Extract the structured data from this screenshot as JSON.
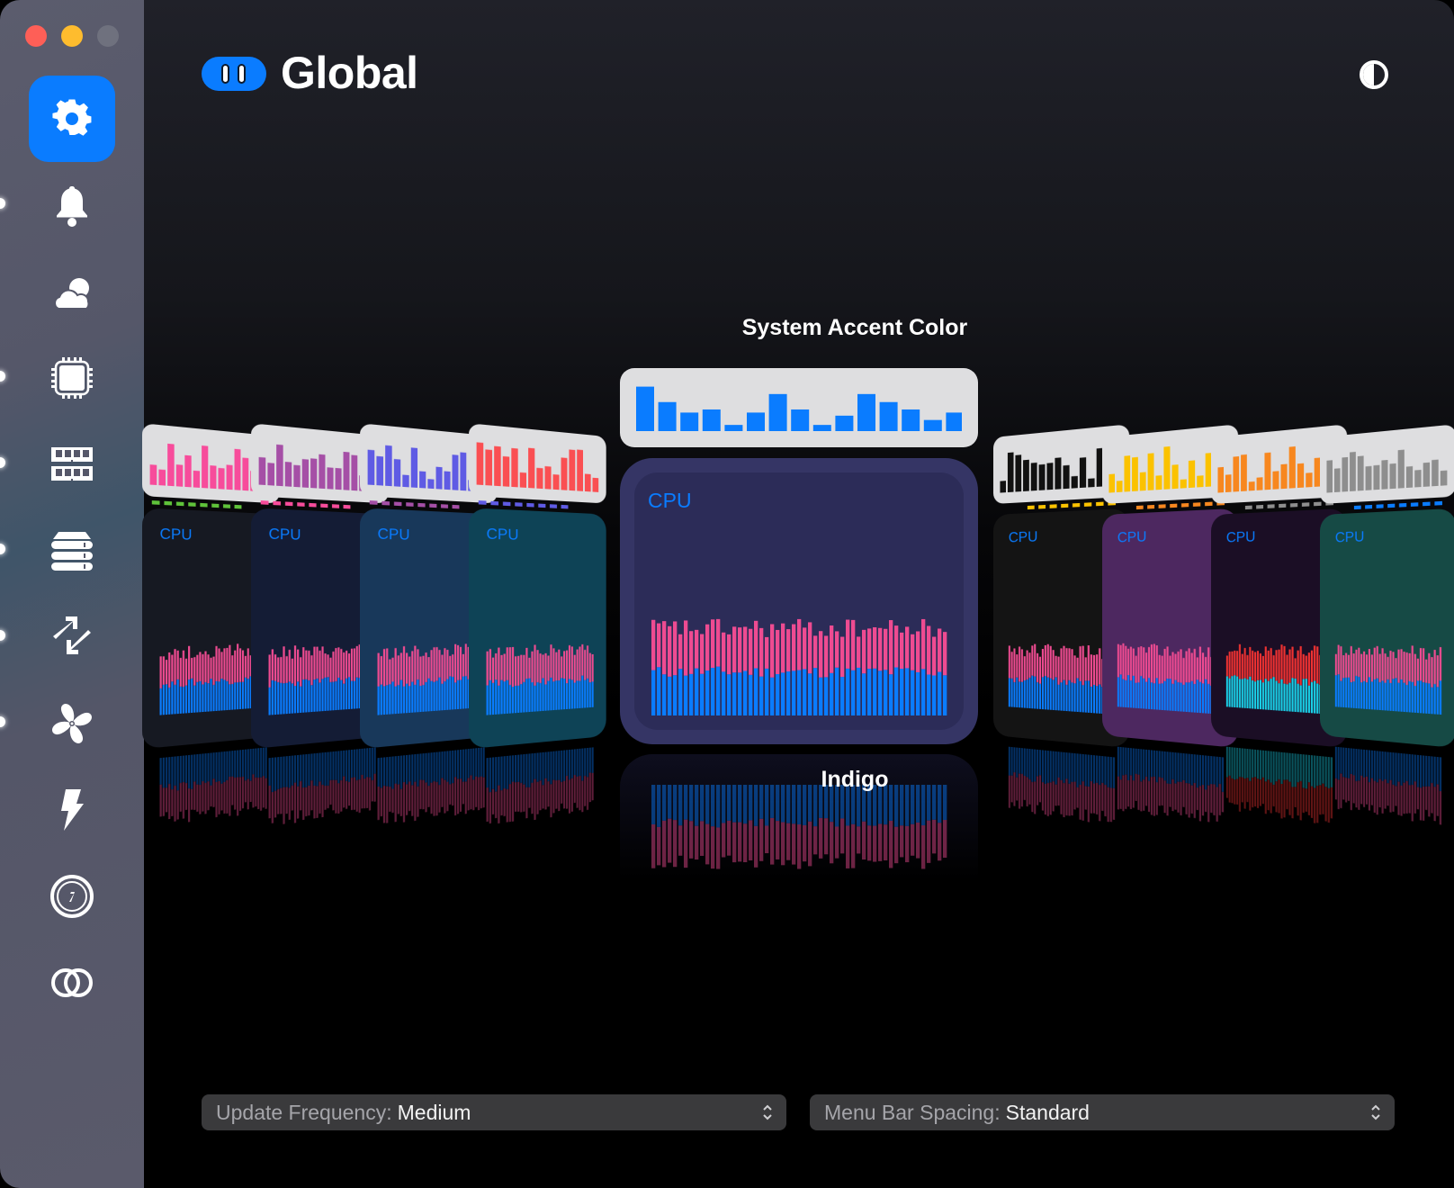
{
  "window": {
    "traffic_lights": [
      "close",
      "minimize",
      "zoom"
    ]
  },
  "sidebar": {
    "items": [
      {
        "name": "general",
        "icon": "gear-icon",
        "active": true
      },
      {
        "name": "notifications",
        "icon": "bell-icon",
        "active": false
      },
      {
        "name": "weather",
        "icon": "cloud-sun-icon",
        "active": false
      },
      {
        "name": "cpu",
        "icon": "cpu-chip-icon",
        "active": false
      },
      {
        "name": "memory",
        "icon": "memory-icon",
        "active": false
      },
      {
        "name": "disk",
        "icon": "disk-stack-icon",
        "active": false
      },
      {
        "name": "network",
        "icon": "arrows-up-down-icon",
        "active": false
      },
      {
        "name": "sensors",
        "icon": "fan-icon",
        "active": false
      },
      {
        "name": "battery",
        "icon": "bolt-icon",
        "active": false
      },
      {
        "name": "time",
        "icon": "clock-icon",
        "active": false
      },
      {
        "name": "combined",
        "icon": "rings-icon",
        "active": false
      }
    ]
  },
  "header": {
    "title": "Global",
    "toggle_icon": "pause-toggle-icon",
    "appearance_icon": "half-circle-icon"
  },
  "theme_picker": {
    "menubar_color_label": "System Accent Color",
    "theme_label": "Indigo",
    "card_label": "CPU",
    "colors": {
      "accent": "#0a7cff",
      "user": "#ee4b91",
      "system": "#0a7cff"
    },
    "menubar_bars": [
      0.72,
      0.47,
      0.3,
      0.35,
      0.1,
      0.3,
      0.6,
      0.35,
      0.1,
      0.25,
      0.6,
      0.47,
      0.35,
      0.18,
      0.3
    ],
    "left_themes": [
      {
        "name": "pink",
        "menubar_color": "#f74c9b",
        "card_bg": "#161922",
        "dash_color": "#5fc23a"
      },
      {
        "name": "purple",
        "menubar_color": "#a54fa6",
        "card_bg": "#141c35",
        "dash_color": "#f74c9b"
      },
      {
        "name": "indigo-blue",
        "menubar_color": "#5f5be4",
        "card_bg": "#18385a",
        "dash_color": "#a54fa6"
      },
      {
        "name": "red",
        "menubar_color": "#fa4f52",
        "card_bg": "#0e4356",
        "dash_color": "#5f5be4"
      }
    ],
    "right_themes": [
      {
        "name": "graphite",
        "menubar_color": "#111111",
        "card_bg": "#141414",
        "dash_color": "#fbc200"
      },
      {
        "name": "yellow",
        "menubar_color": "#fbc200",
        "card_bg": "#4d2860",
        "dash_color": "#f7871f"
      },
      {
        "name": "orange",
        "menubar_color": "#f7871f",
        "card_bg": "#1b0e25",
        "dash_color": "#8e8e8e"
      },
      {
        "name": "gray",
        "menubar_color": "#8e8e8e",
        "card_bg": "#164a45",
        "dash_color": "#0a7cff"
      }
    ]
  },
  "settings": {
    "update_frequency": {
      "label": "Update Frequency:",
      "value": "Medium"
    },
    "menu_bar_spacing": {
      "label": "Menu Bar Spacing:",
      "value": "Standard"
    }
  }
}
